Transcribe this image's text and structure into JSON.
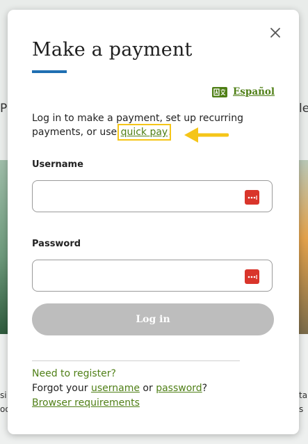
{
  "background": {
    "left_fragment": "P",
    "right_fragment": "le",
    "bottom_left_1": "si",
    "bottom_left_2": "oo",
    "bottom_right_1": "ta",
    "bottom_right_2": "s"
  },
  "modal": {
    "title": "Make a payment",
    "close_icon": "close-icon",
    "language_link": "Español",
    "language_icon": "translate-icon",
    "intro_text": "Log in to make a payment, set up recurring payments, or use ",
    "quick_pay_link": "quick pay",
    "intro_end": ".",
    "arrow_icon": "arrow-left-icon",
    "username": {
      "label": "Username",
      "value": "",
      "placeholder": ""
    },
    "password": {
      "label": "Password",
      "value": "",
      "placeholder": ""
    },
    "password_manager_icon": "password-manager-icon",
    "login_button": "Log in",
    "register_link": "Need to register?",
    "forgot_prefix": "Forgot your ",
    "forgot_username": "username",
    "forgot_or": " or ",
    "forgot_password": "password",
    "forgot_suffix": "?",
    "browser_requirements": "Browser requirements"
  },
  "colors": {
    "accent_green": "#4f7f16",
    "title_rule_blue": "#1f6fb2",
    "highlight_yellow": "#f5c518",
    "disabled_button": "#bdbdbd",
    "password_badge_red": "#d9352b"
  }
}
